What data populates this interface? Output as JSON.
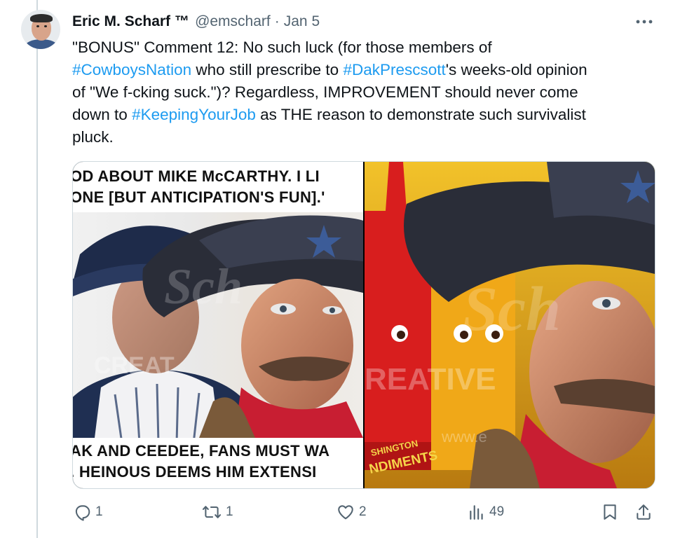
{
  "post": {
    "author_name": "Eric M. Scharf",
    "tm": "™",
    "handle": "@emscharf",
    "separator": "·",
    "date": "Jan 5",
    "more_icon": "more-horizontal-icon",
    "text_lines": [
      [
        {
          "t": "\"BONUS\" Comment 12: No such luck (for those members of",
          "tag": false
        }
      ],
      [
        {
          "t": "#CowboysNation",
          "tag": true
        },
        {
          "t": " who still prescribe to ",
          "tag": false
        },
        {
          "t": "#DakPrescsott",
          "tag": true
        },
        {
          "t": "'s weeks-old opinion",
          "tag": false
        }
      ],
      [
        {
          "t": "of \"We f-cking suck.\")? Regardless, IMPROVEMENT should never come",
          "tag": false
        }
      ],
      [
        {
          "t": "down to ",
          "tag": false
        },
        {
          "t": "#KeepingYourJob",
          "tag": true
        },
        {
          "t": " as THE reason to demonstrate such survivalist",
          "tag": false
        }
      ],
      [
        {
          "t": "pluck.",
          "tag": false
        }
      ]
    ]
  },
  "media": {
    "image1": {
      "top_caption_1": "OD ABOUT MIKE McCARTHY. I LI",
      "top_caption_2": "ONE [BUT ANTICIPATION'S FUN].'",
      "bottom_caption_1": "AK AND CEEDEE, FANS MUST WA",
      "bottom_caption_2": ". HEINOUS DEEMS HIM EXTENSI",
      "watermark_1": "Sch",
      "watermark_2": "CREAT"
    },
    "image2": {
      "bottle_label_1": "SHINGTON",
      "bottle_label_2": "NDIMENTS",
      "watermark_1": "Sch",
      "watermark_2": "REATIVE",
      "watermark_3": "www.e"
    }
  },
  "actions": {
    "reply_icon": "reply-icon",
    "reply_count": "1",
    "repost_icon": "repost-icon",
    "repost_count": "1",
    "like_icon": "heart-icon",
    "like_count": "2",
    "views_icon": "views-bar-chart-icon",
    "views_count": "49",
    "bookmark_icon": "bookmark-icon",
    "share_icon": "share-icon"
  },
  "colors": {
    "link": "#1d9bf0",
    "text": "#0f1419",
    "muted": "#536471",
    "border": "#cfd9de"
  }
}
